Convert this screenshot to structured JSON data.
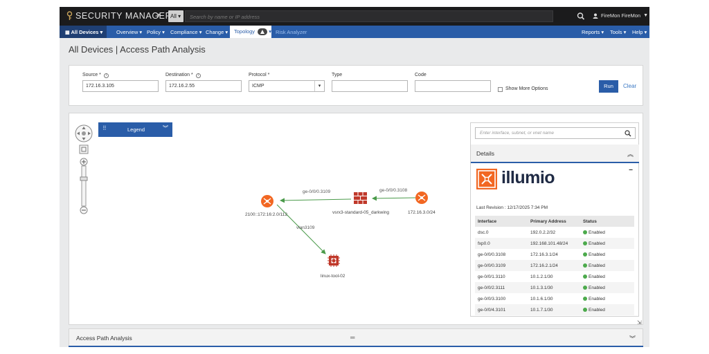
{
  "colors": {
    "accent": "#2a5da8",
    "node": "#f26722",
    "firewall": "#c0392b",
    "enabled": "#4caa4c",
    "edge": "#4a9a4a"
  },
  "topbar": {
    "brand": "SECURITY MANAGER",
    "scope": "All",
    "search_placeholder": "Search by name or IP address",
    "user": "FireMon FireMon"
  },
  "nav": {
    "all_devices": "All Devices",
    "items": [
      "Overview",
      "Policy",
      "Compliance",
      "Change"
    ],
    "topology": "Topology",
    "risk_analyzer": "Risk Analyzer",
    "right_items": [
      "Reports",
      "Tools",
      "Help"
    ]
  },
  "page": {
    "title": "All Devices | Access Path Analysis"
  },
  "form": {
    "source_label": "Source *",
    "source_value": "172.16.3.105",
    "destination_label": "Destination *",
    "destination_value": "172.16.2.55",
    "protocol_label": "Protocol *",
    "protocol_value": "ICMP",
    "type_label": "Type",
    "type_value": "",
    "code_label": "Code",
    "code_value": "",
    "show_more": "Show More Options",
    "run": "Run",
    "clear": "Clear"
  },
  "map": {
    "legend": "Legend",
    "nodes": {
      "router_left": "2100::172:16:2.0/112",
      "firewall": "vsrx3-standard-05_darkwing",
      "router_right": "172.16.3.0/24",
      "host": "linux-tool-02"
    },
    "edges": {
      "fw_to_left": "ge-0/0/0.3109",
      "right_to_fw": "ge-0/0/0.3108",
      "left_to_host": "vlan3109"
    }
  },
  "details": {
    "search_placeholder": "Enter interface, subnet, or vnet name",
    "title": "Details",
    "logo_text": "illumio",
    "last_revision": "Last Revision : 12/17/2025 7:34 PM",
    "columns": [
      "Interface",
      "Primary Address",
      "Status"
    ],
    "rows": [
      {
        "iface": "dsc.0",
        "addr": "192.0.2.2/32",
        "status": "Enabled"
      },
      {
        "iface": "fxp0.0",
        "addr": "192.168.101.48/24",
        "status": "Enabled"
      },
      {
        "iface": "ge-0/0/0.3108",
        "addr": "172.16.3.1/24",
        "status": "Enabled"
      },
      {
        "iface": "ge-0/0/0.3109",
        "addr": "172.16.2.1/24",
        "status": "Enabled"
      },
      {
        "iface": "ge-0/0/1.3110",
        "addr": "10.1.2.1/30",
        "status": "Enabled"
      },
      {
        "iface": "ge-0/0/2.3111",
        "addr": "10.1.3.1/30",
        "status": "Enabled"
      },
      {
        "iface": "ge-0/0/3.3100",
        "addr": "10.1.6.1/30",
        "status": "Enabled"
      },
      {
        "iface": "ge-0/0/4.3101",
        "addr": "10.1.7.1/30",
        "status": "Enabled"
      }
    ]
  },
  "bottom": {
    "title": "Access Path Analysis"
  }
}
